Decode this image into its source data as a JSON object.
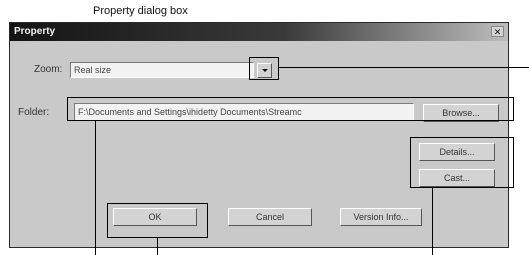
{
  "caption": "Property dialog box",
  "dialog": {
    "title": "Property",
    "close_glyph": "✕"
  },
  "zoom": {
    "label": "Zoom:",
    "value": "Real size"
  },
  "folder": {
    "label": "Folder:",
    "value": "F:\\Documents and Settings\\ihidetty Documents\\Streamc"
  },
  "buttons": {
    "browse": "Browse...",
    "details": "Details...",
    "cast": "Cast...",
    "ok": "OK",
    "cancel": "Cancel",
    "version_info": "Version Info..."
  }
}
